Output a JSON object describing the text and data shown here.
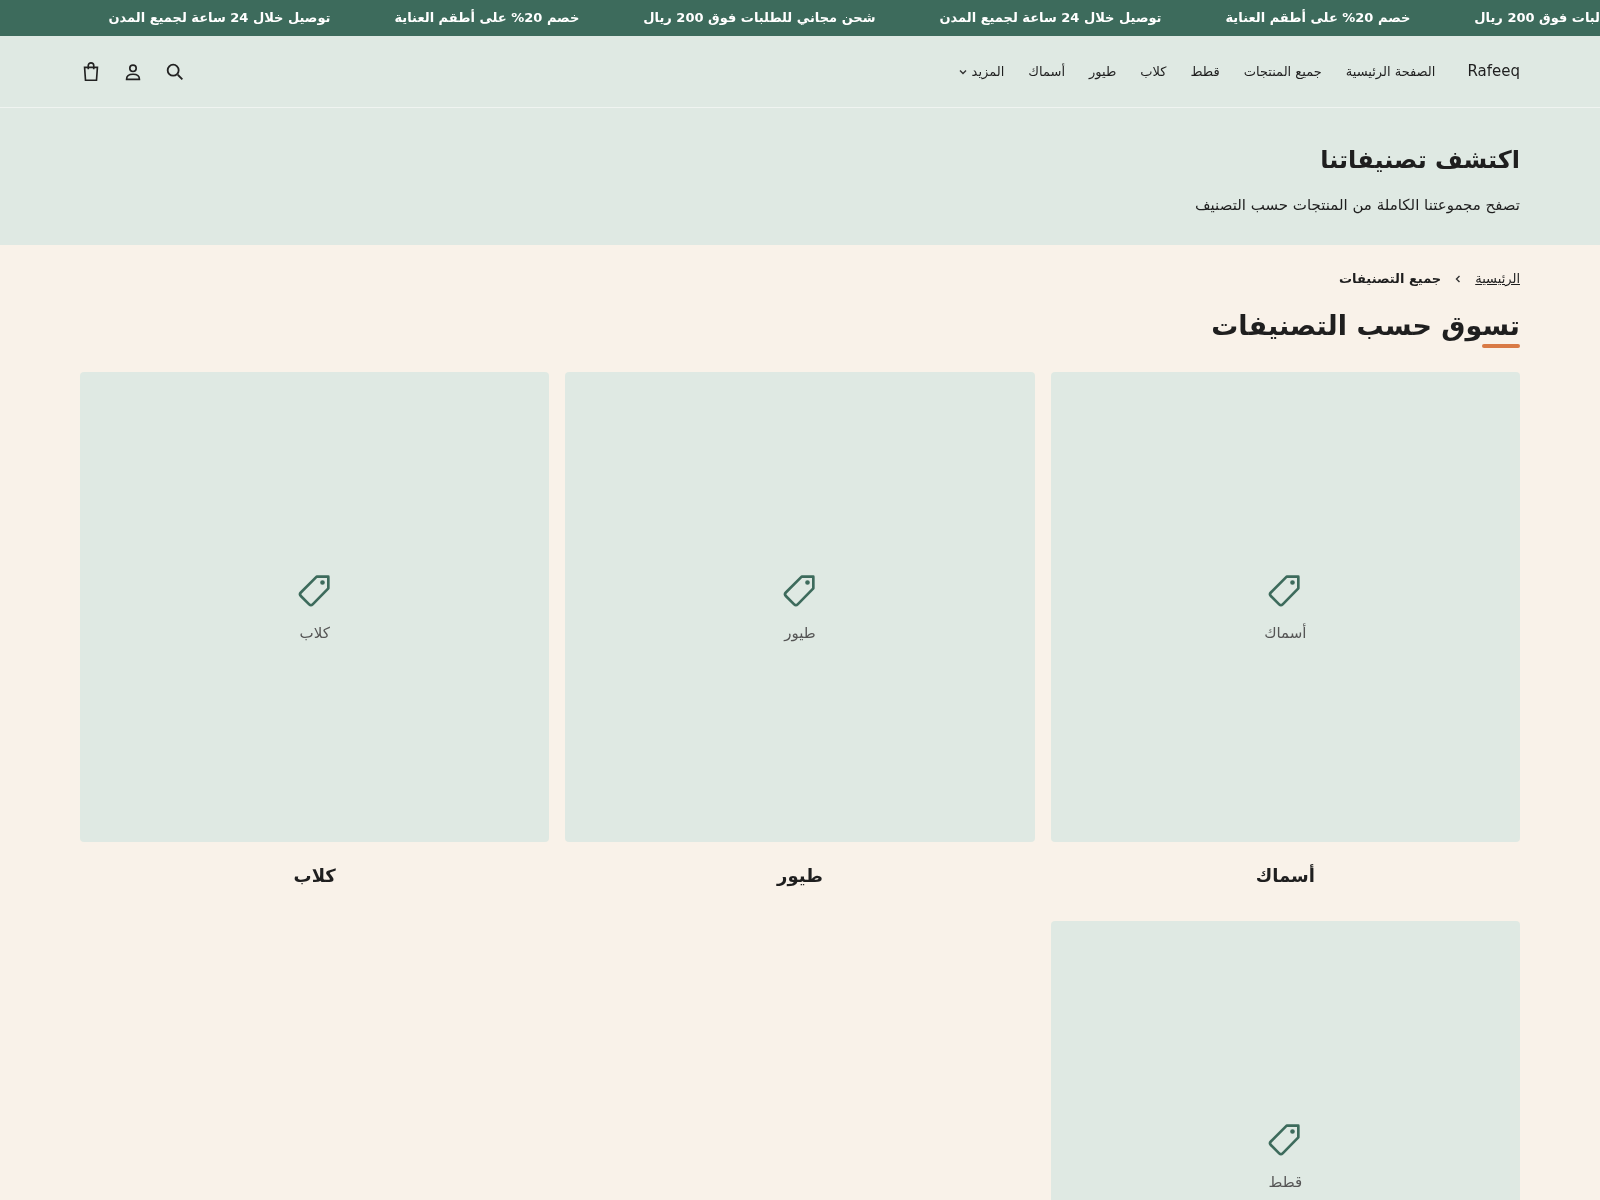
{
  "announcements": [
    "لبات فوق 200 ريال",
    "خصم 20% على أطقم العناية",
    "توصيل خلال 24 ساعة لجميع المدن",
    "شحن مجاني للطلبات فوق 200 ريال",
    "خصم 20% على أطقم العناية",
    "توصيل خلال 24 ساعة لجميع المدن"
  ],
  "header": {
    "logo": "Rafeeq",
    "nav": [
      {
        "label": "الصفحة الرئيسية"
      },
      {
        "label": "جميع المنتجات"
      },
      {
        "label": "قطط"
      },
      {
        "label": "كلاب"
      },
      {
        "label": "طيور"
      },
      {
        "label": "أسماك"
      },
      {
        "label": "المزيد",
        "kind": "dropdown"
      }
    ]
  },
  "hero": {
    "title": "اكتشف تصنيفاتنا",
    "subtitle": "تصفح مجموعتنا الكاملة من المنتجات حسب التصنيف"
  },
  "breadcrumb": {
    "home": "الرئيسية",
    "current": "جميع التصنيفات"
  },
  "section_title": "تسوق حسب التصنيفات",
  "categories": [
    {
      "image_label": "أسماك",
      "title": "أسماك"
    },
    {
      "image_label": "طيور",
      "title": "طيور"
    },
    {
      "image_label": "كلاب",
      "title": "كلاب"
    },
    {
      "image_label": "قطط"
    }
  ]
}
